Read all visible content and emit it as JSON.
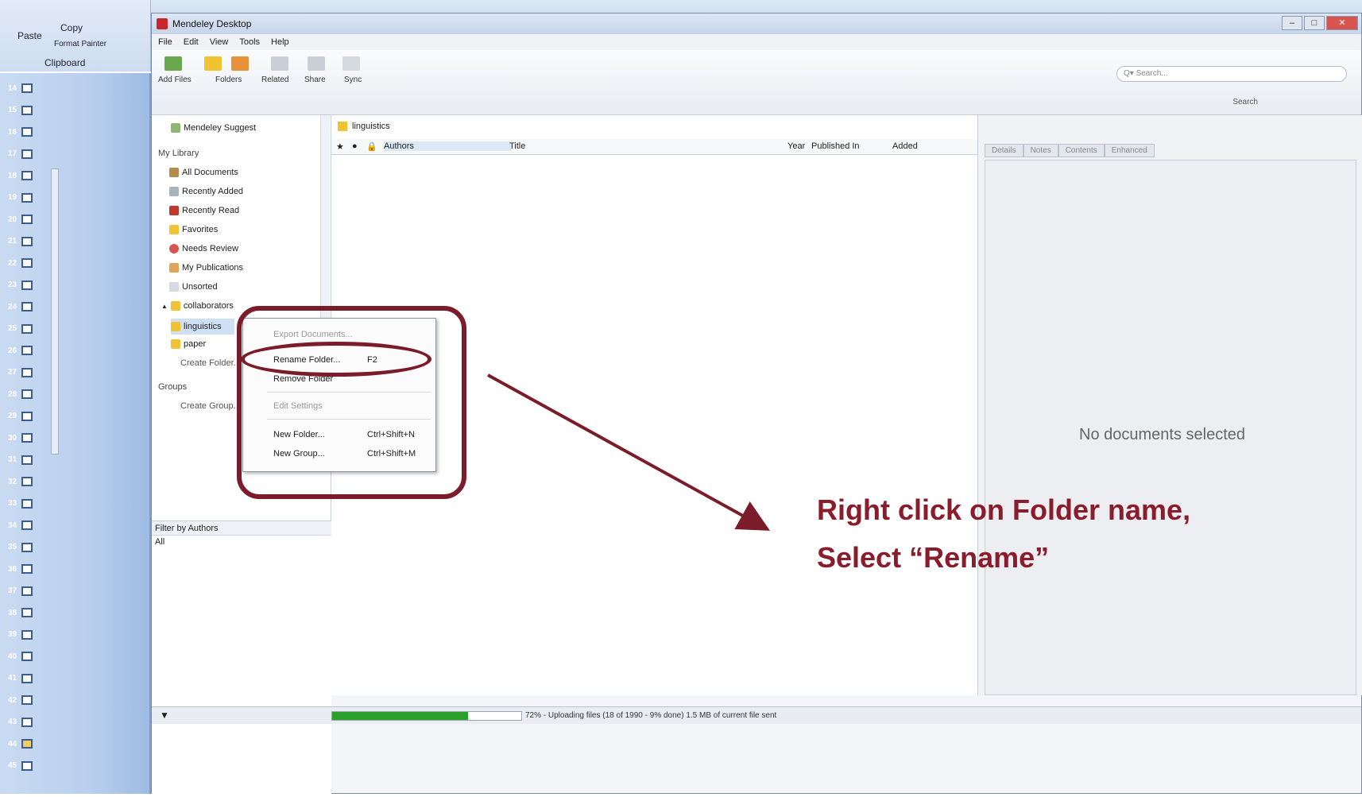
{
  "background_app": {
    "clipboard": {
      "paste": "Paste",
      "copy": "Copy",
      "format_painter": "Format Painter",
      "group_label": "Clipboard"
    },
    "slide_numbers": [
      "14",
      "15",
      "16",
      "17",
      "18",
      "19",
      "20",
      "21",
      "22",
      "23",
      "24",
      "25",
      "26",
      "27",
      "28",
      "29",
      "30",
      "31",
      "32",
      "33",
      "34",
      "35",
      "36",
      "37",
      "38",
      "39",
      "40",
      "41",
      "42",
      "43",
      "44",
      "45"
    ]
  },
  "window": {
    "title": "Mendeley Desktop",
    "controls": {
      "minimize": "–",
      "maximize": "□",
      "close": "✕"
    }
  },
  "menu": [
    "File",
    "Edit",
    "View",
    "Tools",
    "Help"
  ],
  "toolbar": {
    "buttons": [
      {
        "label": "Add Files",
        "icon": "add-document-icon"
      },
      {
        "label": "Folders",
        "icon": "folder-icon"
      },
      {
        "label": "Related",
        "icon": "related-icon"
      },
      {
        "label": "Share",
        "icon": "share-icon"
      },
      {
        "label": "Sync",
        "icon": "sync-icon"
      }
    ],
    "search_placeholder": "Q▾ Search...",
    "search_label": "Search"
  },
  "left_pane": {
    "suggest": "Mendeley Suggest",
    "my_library": "My Library",
    "items": [
      "All Documents",
      "Recently Added",
      "Recently Read",
      "Favorites",
      "Needs Review",
      "My Publications",
      "Unsorted"
    ],
    "collection": "collaborators",
    "selected_folder": "linguistics",
    "other_folder": "paper",
    "create_folder": "Create Folder...",
    "groups": "Groups",
    "create_group": "Create Group...",
    "filter_header": "Filter by Authors",
    "filter_value": "All"
  },
  "center_pane": {
    "breadcrumb": "linguistics",
    "columns": {
      "authors": "Authors",
      "title": "Title",
      "year": "Year",
      "published_in": "Published In",
      "added": "Added"
    }
  },
  "right_pane": {
    "tabs": [
      "Details",
      "Notes",
      "Contents",
      "Enhanced"
    ],
    "empty_message": "No documents selected"
  },
  "status_bar": {
    "progress_fraction": 0.72,
    "text": "72% - Uploading files (18 of 1990 - 9% done) 1.5 MB of current file sent"
  },
  "context_menu": {
    "items": [
      {
        "label": "Export Documents...",
        "shortcut": "",
        "disabled": true
      },
      {
        "label": "Rename Folder...",
        "shortcut": "F2",
        "disabled": false
      },
      {
        "label": "Remove Folder",
        "shortcut": "",
        "disabled": false
      },
      {
        "label": "Edit Settings",
        "shortcut": "",
        "disabled": true
      },
      {
        "label": "New Folder...",
        "shortcut": "Ctrl+Shift+N",
        "disabled": false
      },
      {
        "label": "New Group...",
        "shortcut": "Ctrl+Shift+M",
        "disabled": false
      }
    ]
  },
  "annotation": {
    "line1": "Right click on Folder name,",
    "line2": "Select “Rename”",
    "color": "#8a1c2c"
  }
}
